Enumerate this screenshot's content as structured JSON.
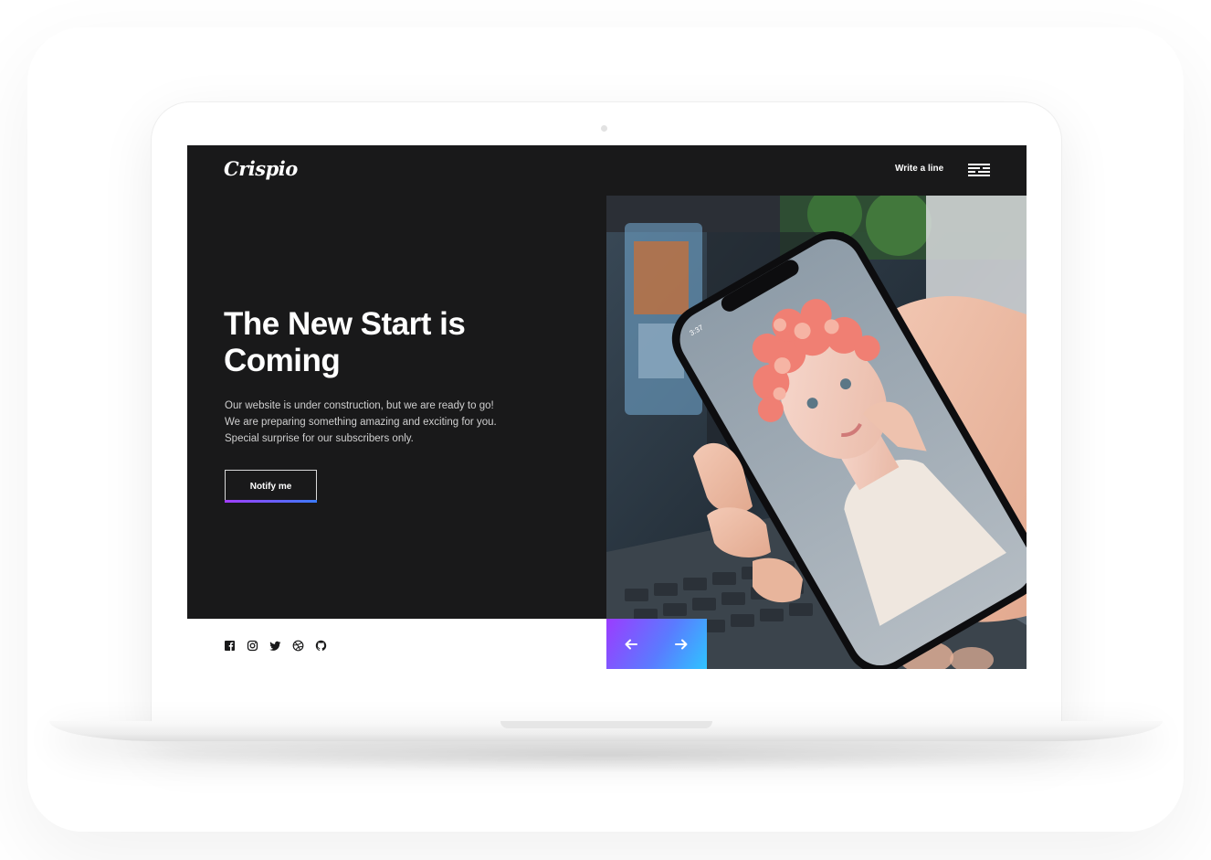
{
  "brand": {
    "logo": "Crispio"
  },
  "header": {
    "write_link": "Write a line"
  },
  "hero": {
    "title": "The New Start is Coming",
    "lines": [
      "Our website is under construction, but we are ready to go!",
      "We are preparing something amazing and exciting for you.",
      "Special surprise for our subscribers only."
    ],
    "button_label": "Notify me"
  },
  "phone": {
    "time": "3:37"
  },
  "social_icons": [
    "facebook-icon",
    "instagram-icon",
    "twitter-icon",
    "dribbble-icon",
    "github-icon"
  ],
  "slider_controls": [
    "arrow-left-icon",
    "arrow-right-icon"
  ],
  "colors": {
    "panel": "#19191a",
    "gradient_start": "#9b3cff",
    "gradient_end": "#2fc4ff"
  }
}
